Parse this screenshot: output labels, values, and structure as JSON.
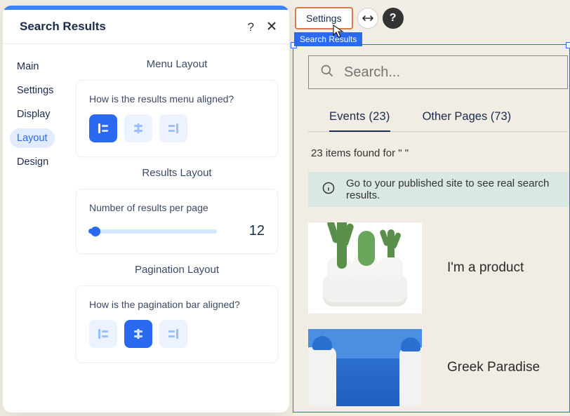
{
  "panel": {
    "title": "Search Results",
    "tabs": {
      "main": "Main",
      "settings": "Settings",
      "display": "Display",
      "layout": "Layout",
      "design": "Design"
    },
    "sections": {
      "menu_layout_title": "Menu Layout",
      "menu_layout_q": "How is the results menu aligned?",
      "results_layout_title": "Results Layout",
      "results_per_page_label": "Number of results per page",
      "results_per_page_value": "12",
      "pagination_layout_title": "Pagination Layout",
      "pagination_q": "How is the pagination bar aligned?"
    }
  },
  "toolbar": {
    "settings_label": "Settings",
    "selection_badge": "Search Results"
  },
  "preview": {
    "search_placeholder": "Search...",
    "tab_events": "Events (23)",
    "tab_other": "Other Pages (73)",
    "items_found": "23 items found for \" \"",
    "notice": "Go to your published site to see real search results.",
    "result1_title": "I'm a product",
    "result2_title": "Greek Paradise"
  }
}
